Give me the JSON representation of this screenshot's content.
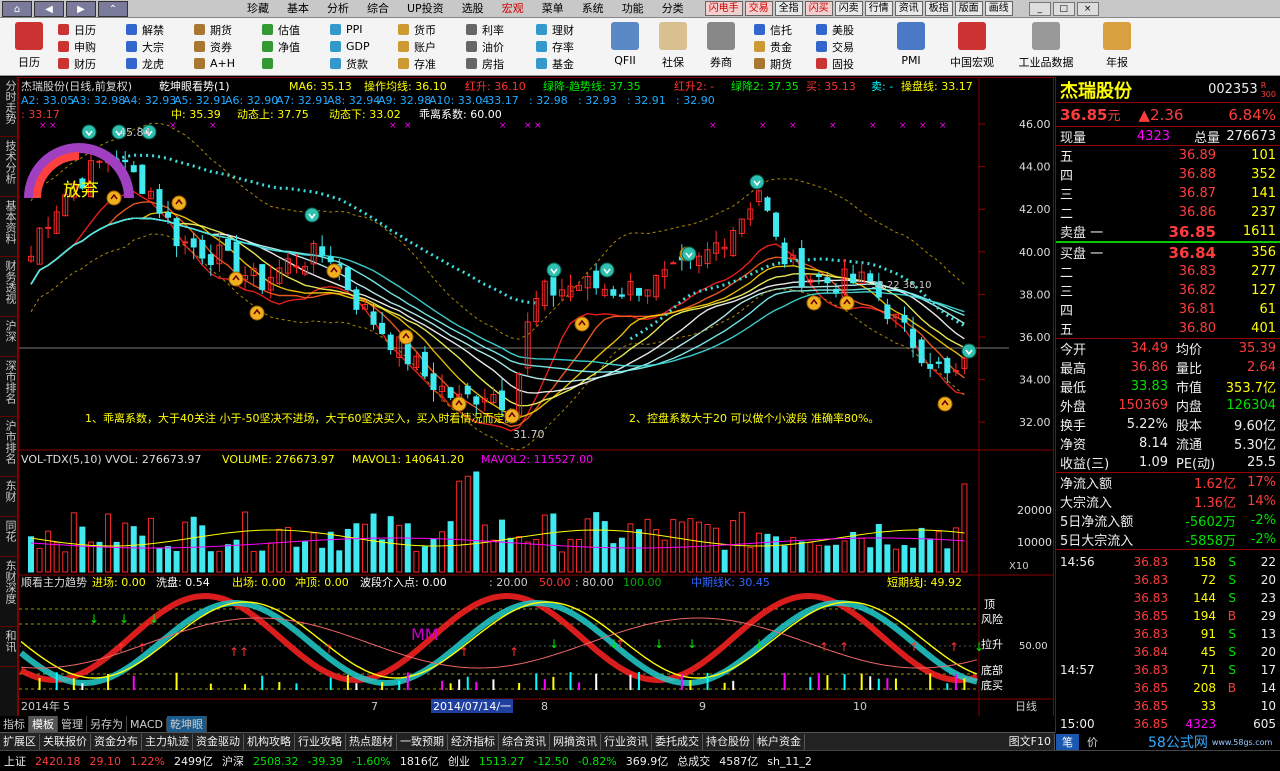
{
  "topbar": {
    "nav": [
      "⌂",
      "◀",
      "▶",
      "⌃"
    ],
    "menu": [
      "珍藏",
      "基本",
      "分析",
      "综合",
      "UP投资",
      "选股",
      "宏观",
      "菜单",
      "系统",
      "功能",
      "分类"
    ],
    "active": "宏观",
    "quick": [
      "闪电手",
      "交易",
      "全指",
      "闪买",
      "闪卖",
      "行情",
      "资讯",
      "板指",
      "版面",
      "画线"
    ]
  },
  "toolbar": {
    "grid": [
      [
        "日历",
        "解禁",
        "期货",
        "估值",
        "PPI",
        "货币",
        "利率",
        "理财"
      ],
      [
        "申购",
        "大宗",
        "资券",
        "净值",
        "GDP",
        "账户",
        "油价",
        "存率"
      ],
      [
        "财历",
        "龙虎",
        "A+H",
        "",
        "货款",
        "存准",
        "房指",
        "基金"
      ]
    ],
    "big": [
      "QFII",
      "社保",
      "券商",
      "期货",
      "PMI",
      "中国宏观",
      "工业品数据",
      "年报"
    ],
    "extra": [
      [
        "信托",
        "美股"
      ],
      [
        "贵金",
        "交易"
      ],
      [
        "期货",
        "固投"
      ]
    ]
  },
  "leftbar": [
    "分时走势",
    "技术分析",
    "基本资料",
    "财务透视",
    "沪深",
    "深市排名",
    "沪市排名",
    "东财",
    "同花",
    "东财深度",
    "和讯"
  ],
  "chart": {
    "header": "杰瑞股份(日线,前复权)",
    "indicator": "乾坤眼看势(1)",
    "ma6": "MA6: 35.13",
    "op": "操作均线: 36.10",
    "hs": "红升: 36.10",
    "ld": "绿降-趋势线: 37.35",
    "hs2": "红升2: -",
    "ld2": "绿降2: 37.35",
    "buy": "买: 35.13",
    "sell": "卖: -",
    "cp": "操盘线: 33.17",
    "line2": [
      "A2: 33.05",
      "A3: 32.98",
      "A4: 32.93",
      "A5: 32.91",
      "A6: 32.90",
      "A7: 32.91",
      "A8: 32.94",
      "A9: 32.98",
      "A10: 33.04",
      ": 33.17",
      ": 32.98",
      ": 32.93",
      ": 32.91",
      ": 32.90"
    ],
    "line3": [
      ": 33.17",
      "中: 35.39",
      "动态上: 37.75",
      "动态下: 33.02",
      "乖离系数: 60.00"
    ],
    "yticks": [
      "46.00",
      "44.00",
      "42.00",
      "40.00",
      "38.00",
      "36.00",
      "34.00",
      "32.00"
    ],
    "note1": "1、乖离系数，大于40关注 小于-50坚决不进场，大于60坚决买入，买入时看情况而定。",
    "note2": "2、控盘系数大于20 可以做个小波段 准确率80%。",
    "hi": "45.84",
    "lo": "31.70",
    "mark": "38.22 38.10",
    "stamp": "放弃",
    "vol": {
      "title": "VOL-TDX(5,10)",
      "vvol": "VVOL: 276673.97",
      "volume": "VOLUME: 276673.97",
      "mavol1": "MAVOL1: 140641.20",
      "mavol2": "MAVOL2: 115527.00",
      "yticks": [
        "20000",
        "10000"
      ],
      "x10": "X10"
    },
    "ind": {
      "title": "顺看主力趋势",
      "jc": "进场: 0.00",
      "xp": "洗盘: 0.54",
      "cc": "出场: 0.00",
      "cx": "冲顶: 0.00",
      "bd": "波段介入点: 0.00",
      "v20": ": 20.00",
      "v50": "50.00",
      "v80": ": 80.00",
      "v100": "100.00",
      "zq": "中期线K: 30.45",
      "dq": "短期线J: 49.92",
      "labels": [
        "顶",
        "风险",
        "拉升",
        "底部",
        "底买"
      ],
      "tick50": "50.00",
      "mm": "MM"
    },
    "xaxis": {
      "year": "2014年",
      "m5": "5",
      "m7": "7",
      "sel": "2014/07/14/一",
      "m8": "8",
      "m9": "9",
      "m10": "10",
      "day": "日线"
    }
  },
  "quote": {
    "name": "杰瑞股份",
    "code": "002353",
    "r": "R",
    "r300": "300",
    "price": "36.85",
    "unit": "元",
    "chg": "▲2.36",
    "pct": "6.84%",
    "xian": "现量",
    "xianv": "4323",
    "zong": "总量",
    "zongv": "276673",
    "sells": [
      [
        "五",
        "36.89",
        "101"
      ],
      [
        "四",
        "36.88",
        "352"
      ],
      [
        "三",
        "36.87",
        "141"
      ],
      [
        "二",
        "36.86",
        "237"
      ],
      [
        "卖盘 一",
        "36.85",
        "1611"
      ]
    ],
    "buys": [
      [
        "买盘 一",
        "36.84",
        "356"
      ],
      [
        "二",
        "36.83",
        "277"
      ],
      [
        "三",
        "36.82",
        "127"
      ],
      [
        "四",
        "36.81",
        "61"
      ],
      [
        "五",
        "36.80",
        "401"
      ]
    ],
    "stats": [
      [
        "今开",
        "34.49",
        "均价",
        "35.39"
      ],
      [
        "最高",
        "36.86",
        "量比",
        "2.64"
      ],
      [
        "最低",
        "33.83",
        "市值",
        "353.7亿"
      ],
      [
        "外盘",
        "150369",
        "内盘",
        "126304"
      ],
      [
        "换手",
        "5.22%",
        "股本",
        "9.60亿"
      ],
      [
        "净资",
        "8.14",
        "流通",
        "5.30亿"
      ],
      [
        "收益(三)",
        "1.09",
        "PE(动)",
        "25.5"
      ]
    ],
    "flows": [
      [
        "净流入额",
        "1.62亿",
        "17%"
      ],
      [
        "大宗流入",
        "1.36亿",
        "14%"
      ],
      [
        "5日净流入额",
        "-5602万",
        "-2%"
      ],
      [
        "5日大宗流入",
        "-5858万",
        "-2%"
      ]
    ],
    "ticks": [
      [
        "14:56",
        "36.83",
        "158",
        "S",
        "22"
      ],
      [
        "",
        "36.83",
        "72",
        "S",
        "20"
      ],
      [
        "",
        "36.83",
        "144",
        "S",
        "23"
      ],
      [
        "",
        "36.85",
        "194",
        "B",
        "29"
      ],
      [
        "",
        "36.83",
        "91",
        "S",
        "13"
      ],
      [
        "",
        "36.84",
        "45",
        "S",
        "20"
      ],
      [
        "14:57",
        "36.83",
        "71",
        "S",
        "17"
      ],
      [
        "",
        "36.85",
        "208",
        "B",
        "14"
      ],
      [
        "",
        "36.85",
        "33",
        "",
        "10"
      ],
      [
        "15:00",
        "36.85",
        "4323",
        "",
        "605"
      ]
    ],
    "tabs": [
      "笔",
      "价"
    ],
    "watermark": "58公式网",
    "wmurl": "www.58gs.com"
  },
  "tabbar": [
    "指标",
    "模板",
    "管理",
    "另存为",
    "MACD",
    "乾坤眼"
  ],
  "tabsel": "模板",
  "funcbar": [
    "扩展区",
    "关联报价",
    "资金分布",
    "主力轨迹",
    "资金驱动",
    "机构攻略",
    "行业攻略",
    "热点题材",
    "一致预期",
    "经济指标",
    "综合资讯",
    "网摘资讯",
    "行业资讯",
    "委托成交",
    "持仓股份",
    "帐户资金"
  ],
  "funcright": "图文F10",
  "status": {
    "sh": "上证",
    "shv": "2420.18",
    "shc": "29.10",
    "shp": "1.22%",
    "sha": "2499亿",
    "sz": "沪深",
    "szv": "2508.32",
    "szc": "-39.39",
    "szp": "-1.60%",
    "sza": "1816亿",
    "cy": "创业",
    "cyv": "1513.27",
    "cyc": "-12.50",
    "cyp": "-0.82%",
    "cya": "369.9亿",
    "zcj": "总成交",
    "zcjv": "4587亿",
    "code": "sh_11_2"
  }
}
